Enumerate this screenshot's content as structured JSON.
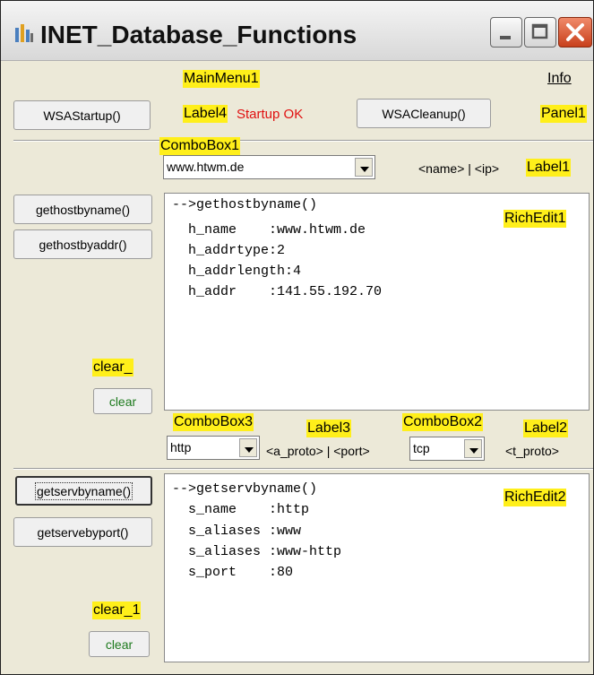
{
  "window": {
    "title": "INET_Database_Functions",
    "icons": {
      "app": "database-app-icon",
      "minimize": "minimize-icon",
      "maximize": "maximize-icon",
      "close": "close-icon"
    }
  },
  "menu": {
    "component": "MainMenu1",
    "info": "Info"
  },
  "startup": {
    "startup_button": "WSAStartup()",
    "label4": "Label4",
    "status": "Startup OK",
    "cleanup_button": "WSACleanup()",
    "panel1": "Panel1"
  },
  "host": {
    "combobox_label": "ComboBox1",
    "combobox_value": "www.htwm.de",
    "hint": "<name> | <ip>",
    "label1": "Label1",
    "gethostbyname_button": "gethostbyname()",
    "gethostbyaddr_button": "gethostbyaddr()",
    "clear_label": "clear_",
    "clear_button": "clear",
    "richedit_label": "RichEdit1",
    "output": [
      "-->gethostbyname()",
      "  h_name    :www.htwm.de",
      "  h_addrtype:2",
      "  h_addrlength:4",
      "  h_addr    :141.55.192.70"
    ]
  },
  "serv": {
    "combobox3_label": "ComboBox3",
    "combobox3_value": "http",
    "label3": "Label3",
    "a_proto_hint": "<a_proto> | <port>",
    "combobox2_label": "ComboBox2",
    "combobox2_value": "tcp",
    "label2": "Label2",
    "t_proto_hint": "<t_proto>",
    "getservbyname_button": "getservbyname()",
    "getservbyport_button": "getservebyport()",
    "clear_label": "clear_1",
    "clear_button": "clear",
    "richedit_label": "RichEdit2",
    "output": [
      "-->getservbyname()",
      "  s_name    :http",
      "  s_aliases :www",
      "  s_aliases :www-http",
      "  s_port    :80"
    ]
  },
  "colors": {
    "highlight": "#ffef1a",
    "status_red": "#e01010",
    "clear_green": "#1d7a1d"
  }
}
